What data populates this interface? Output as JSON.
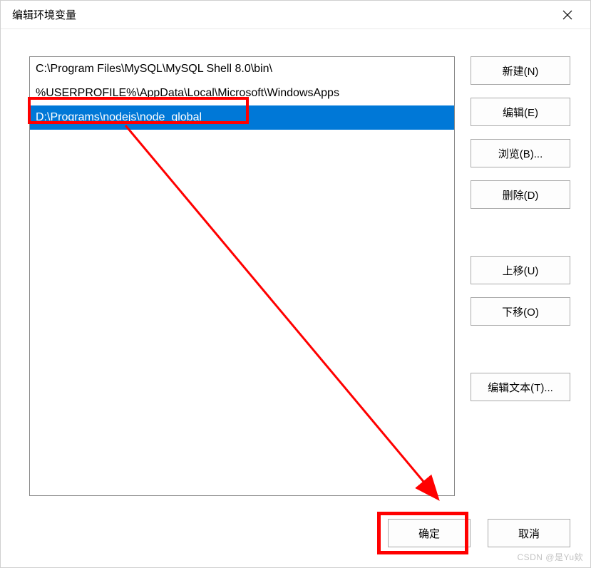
{
  "dialog": {
    "title": "编辑环境变量"
  },
  "list": {
    "items": [
      {
        "value": "C:\\Program Files\\MySQL\\MySQL Shell 8.0\\bin\\",
        "selected": false
      },
      {
        "value": "%USERPROFILE%\\AppData\\Local\\Microsoft\\WindowsApps",
        "selected": false
      },
      {
        "value": "D:\\Programs\\nodejs\\node_global",
        "selected": true
      }
    ]
  },
  "buttons": {
    "new": "新建(N)",
    "edit": "编辑(E)",
    "browse": "浏览(B)...",
    "delete": "删除(D)",
    "moveUp": "上移(U)",
    "moveDown": "下移(O)",
    "editText": "编辑文本(T)...",
    "ok": "确定",
    "cancel": "取消"
  },
  "watermark": "CSDN @是Yu欸"
}
